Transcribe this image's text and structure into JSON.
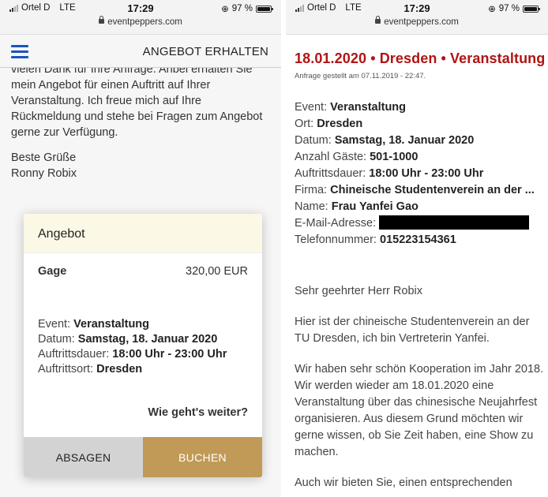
{
  "left_phone": {
    "status": {
      "carrier": "Ortel D",
      "network": "LTE",
      "time": "17:29",
      "url": "eventpeppers.com",
      "battery": "97 %",
      "battery_level": 0.97
    },
    "nav": {
      "title": "ANGEBOT ERHALTEN"
    },
    "message": {
      "body": "vielen Dank für Ihre Anfrage. Anbei erhalten Sie mein Angebot für einen Auftritt auf Ihrer Veranstaltung. Ich freue mich auf Ihre Rückmeldung und stehe bei Fragen zum Angebot gerne zur Verfügung.",
      "closing": "Beste Grüße",
      "signature": "Ronny Robix"
    },
    "offer": {
      "title": "Angebot",
      "fee_label": "Gage",
      "fee_value": "320,00 EUR",
      "event_label": "Event:",
      "event_value": "Veranstaltung",
      "date_label": "Datum:",
      "date_value": "Samstag, 18. Januar 2020",
      "duration_label": "Auftrittsdauer:",
      "duration_value": "18:00 Uhr - 23:00 Uhr",
      "location_label": "Auftrittsort:",
      "location_value": "Dresden",
      "next_label": "Wie geht's weiter?",
      "decline_label": "ABSAGEN",
      "book_label": "BUCHEN"
    }
  },
  "right_phone": {
    "status": {
      "carrier": "Ortel D",
      "network": "LTE",
      "time": "17:29",
      "url": "eventpeppers.com",
      "battery": "97 %",
      "battery_level": 0.97
    },
    "title": "18.01.2020 • Dresden • Veranstaltung",
    "subtitle": "Anfrage gestellt am 07.11.2019 - 22:47.",
    "fields": {
      "event_label": "Event:",
      "event_value": "Veranstaltung",
      "location_label": "Ort:",
      "location_value": "Dresden",
      "date_label": "Datum:",
      "date_value": "Samstag, 18. Januar 2020",
      "guests_label": "Anzahl Gäste:",
      "guests_value": "501-1000",
      "duration_label": "Auftrittsdauer:",
      "duration_value": "18:00 Uhr - 23:00 Uhr",
      "company_label": "Firma:",
      "company_value": "Chineische Studentenverein an der ...",
      "name_label": "Name:",
      "name_value": "Frau Yanfei Gao",
      "email_label": "E-Mail-Adresse:",
      "phone_label": "Telefonnummer:",
      "phone_value": "015223154361"
    },
    "letter": [
      "Sehr geehrter Herr Robix",
      "Hier ist der chineische Studentenverein an der TU Dresden, ich bin Vertreterin Yanfei.",
      "Wir haben sehr schön Kooperation im Jahr 2018. Wir werden wieder am 18.01.2020 eine Veranstaltung über das chinesische Neujahrfest organisieren. Aus diesem Grund möchten wir gerne wissen, ob Sie Zeit haben, eine Show zu machen.",
      "Auch wir bieten Sie, einen entsprechenden"
    ]
  },
  "colors": {
    "accent_blue": "#1a56b8",
    "title_red": "#b01414",
    "book_gold": "#c09a56",
    "decline_grey": "#d3d3d3",
    "card_header": "#fcf8e6"
  },
  "icons": [
    "signal-icon",
    "lock-icon",
    "alarm-icon",
    "battery-icon",
    "hamburger-menu-icon"
  ]
}
